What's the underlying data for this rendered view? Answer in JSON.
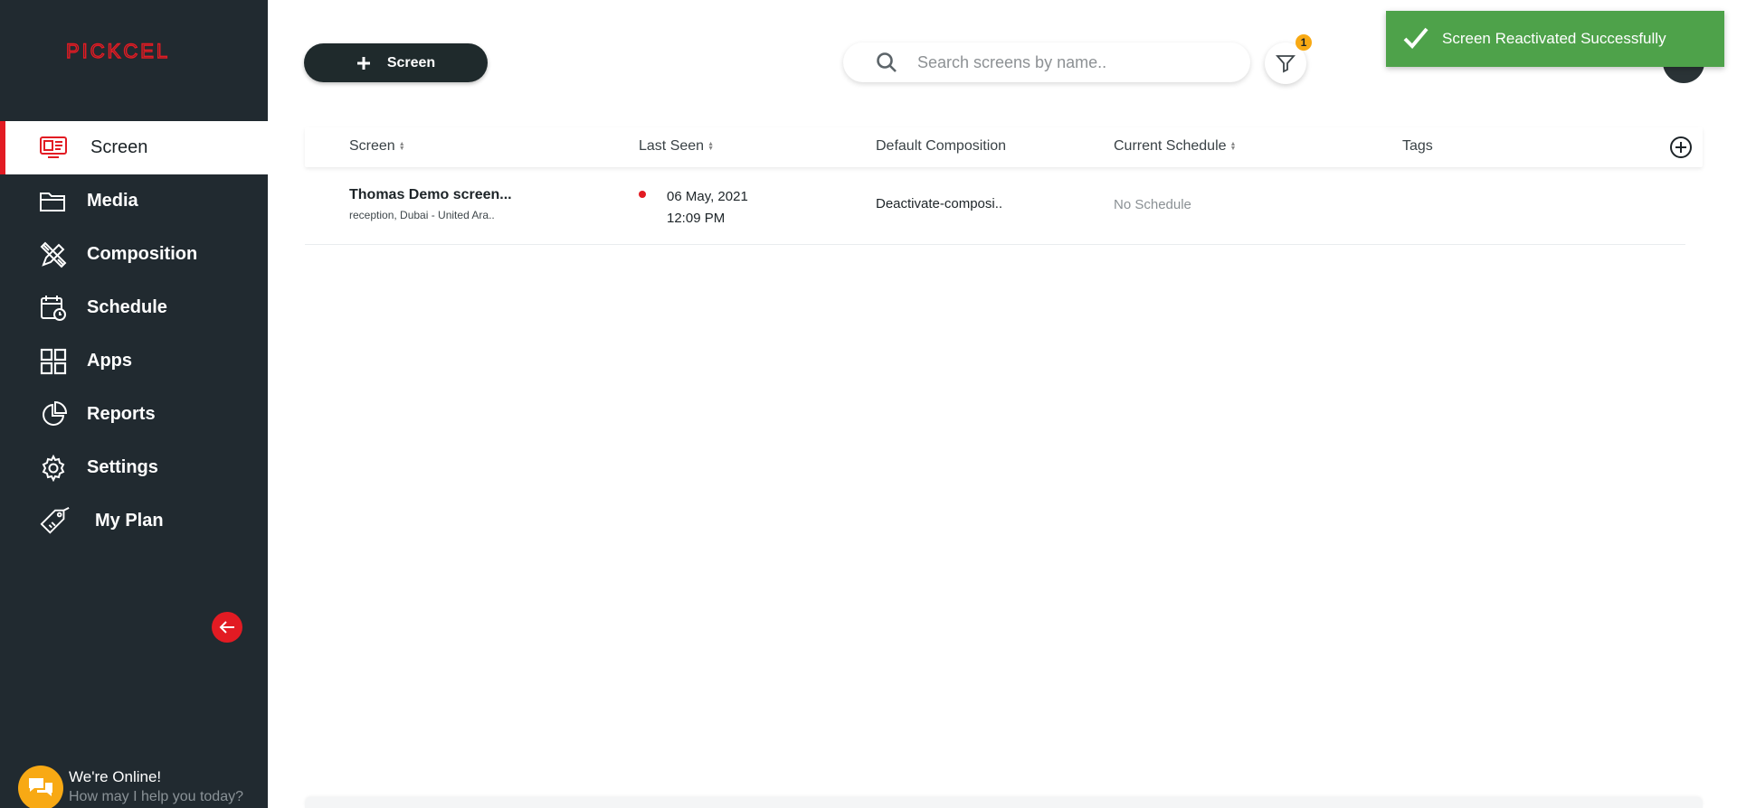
{
  "app": {
    "logo": "PICKCEL"
  },
  "sidebar": {
    "items": [
      {
        "label": "Screen",
        "icon": "monitor-icon",
        "active": true
      },
      {
        "label": "Media",
        "icon": "folder-icon"
      },
      {
        "label": "Composition",
        "icon": "pencil-ruler-icon"
      },
      {
        "label": "Schedule",
        "icon": "calendar-clock-icon"
      },
      {
        "label": "Apps",
        "icon": "grid-icon"
      },
      {
        "label": "Reports",
        "icon": "pie-chart-icon"
      },
      {
        "label": "Settings",
        "icon": "gear-icon"
      },
      {
        "label": "My Plan",
        "icon": "price-tag-icon"
      }
    ],
    "collapse_icon": "arrow-left-icon"
  },
  "chat": {
    "title": "We're Online!",
    "subtitle": "How may I help you today?"
  },
  "toolbar": {
    "add_label": "Screen",
    "search_placeholder": "Search screens by name..",
    "filter_count": "1"
  },
  "toast": {
    "message": "Screen Reactivated Successfully"
  },
  "table": {
    "columns": [
      "Screen",
      "Last Seen",
      "Default Composition",
      "Current Schedule",
      "Tags"
    ],
    "rows": [
      {
        "name": "Thomas Demo screen...",
        "location": "reception, Dubai - United Ara..",
        "last_seen_date": "06 May, 2021",
        "last_seen_time": "12:09 PM",
        "composition": "Deactivate-composi..",
        "schedule": "No Schedule",
        "tags": ""
      }
    ]
  },
  "colors": {
    "brand": "#e21b23",
    "sidebar": "#212a30",
    "toast": "#4ea24a",
    "badge": "#f8a914"
  }
}
